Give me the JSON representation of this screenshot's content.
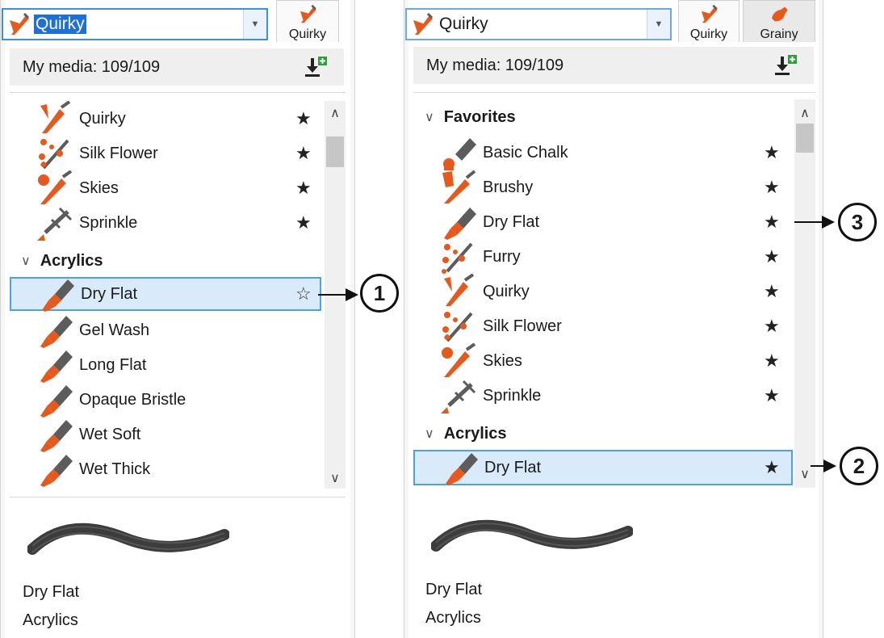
{
  "colors": {
    "accent": "#e8581a",
    "brush_gray": "#5c5c5c",
    "selection_bg": "#d9ebfb",
    "selection_border": "#4ba3e6"
  },
  "left": {
    "variant_select": {
      "value": "Quirky"
    },
    "tabs": [
      {
        "label": "Quirky"
      }
    ],
    "media_bar": {
      "label": "My media: 109/109",
      "import_icon": "import-icon"
    },
    "rows": [
      {
        "name": "Quirky",
        "icon": "quirky-brush-icon",
        "starred": true
      },
      {
        "name": "Silk Flower",
        "icon": "silk-flower-brush-icon",
        "starred": true
      },
      {
        "name": "Skies",
        "icon": "skies-brush-icon",
        "starred": true
      },
      {
        "name": "Sprinkle",
        "icon": "sprinkle-brush-icon",
        "starred": true
      }
    ],
    "group": {
      "label": "Acrylics"
    },
    "group_rows": [
      {
        "name": "Dry Flat",
        "icon": "flat-brush-icon",
        "starred": false,
        "selected": true
      },
      {
        "name": "Gel Wash",
        "icon": "flat-brush-icon"
      },
      {
        "name": "Long Flat",
        "icon": "flat-brush-icon"
      },
      {
        "name": "Opaque Bristle",
        "icon": "flat-brush-icon"
      },
      {
        "name": "Wet Soft",
        "icon": "flat-brush-icon"
      },
      {
        "name": "Wet Thick",
        "icon": "flat-brush-icon"
      }
    ],
    "info": {
      "name": "Dry Flat",
      "category": "Acrylics"
    },
    "callout": "1"
  },
  "right": {
    "variant_select": {
      "value": "Quirky"
    },
    "tabs": [
      {
        "label": "Quirky"
      },
      {
        "label": "Grainy"
      }
    ],
    "media_bar": {
      "label": "My media: 109/109",
      "import_icon": "import-icon"
    },
    "favorites_group": {
      "label": "Favorites"
    },
    "favorites": [
      {
        "name": "Basic Chalk",
        "icon": "chalk-icon",
        "starred": true
      },
      {
        "name": "Brushy",
        "icon": "brushy-icon",
        "starred": true
      },
      {
        "name": "Dry Flat",
        "icon": "flat-brush-icon",
        "starred": true
      },
      {
        "name": "Furry",
        "icon": "furry-brush-icon",
        "starred": true
      },
      {
        "name": "Quirky",
        "icon": "quirky-brush-icon",
        "starred": true
      },
      {
        "name": "Silk Flower",
        "icon": "silk-flower-brush-icon",
        "starred": true
      },
      {
        "name": "Skies",
        "icon": "skies-brush-icon",
        "starred": true
      },
      {
        "name": "Sprinkle",
        "icon": "sprinkle-brush-icon",
        "starred": true
      }
    ],
    "group": {
      "label": "Acrylics"
    },
    "group_rows": [
      {
        "name": "Dry Flat",
        "icon": "flat-brush-icon",
        "starred": true,
        "selected": true
      }
    ],
    "info": {
      "name": "Dry Flat",
      "category": "Acrylics"
    },
    "callouts": [
      "3",
      "2"
    ]
  }
}
